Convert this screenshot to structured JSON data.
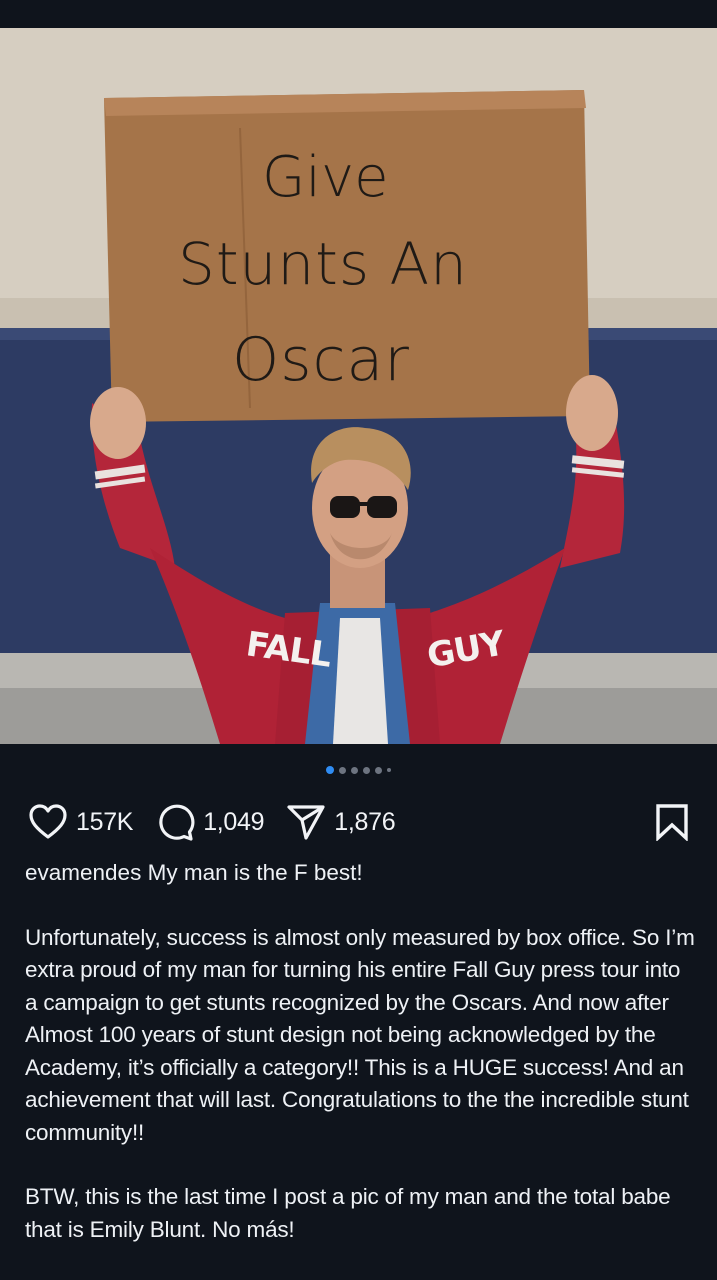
{
  "post_image": {
    "sign_lines": [
      "Give",
      "Stunts An",
      "Oscar"
    ],
    "jacket_text": [
      "FALL",
      "GUY"
    ]
  },
  "carousel": {
    "total": 6,
    "active_index": 0
  },
  "actions": {
    "likes": "157K",
    "comments": "1,049",
    "shares": "1,876",
    "icons": [
      "heart-icon",
      "comment-icon",
      "share-icon",
      "bookmark-icon"
    ]
  },
  "caption": {
    "username": "evamendes",
    "headline": "My man is the F best!",
    "body_paragraph": "Unfortunately, success is almost only measured by box office. So I’m extra proud of my man for turning his entire Fall Guy press tour into a campaign to get stunts recognized by the Oscars. And now after Almost 100 years of stunt design not being acknowledged by the Academy, it’s officially a category!! This is a HUGE success! And an achievement that will last. Congratulations to the the incredible stunt community!!",
    "closing_paragraph": "BTW, this is the last time I post a pic of my man and the total babe that is Emily Blunt. No más!"
  },
  "colors": {
    "background": "#0f141c",
    "text": "#eef1f5",
    "active_dot": "#2f8cf2",
    "inactive_dot": "#6d7480"
  }
}
